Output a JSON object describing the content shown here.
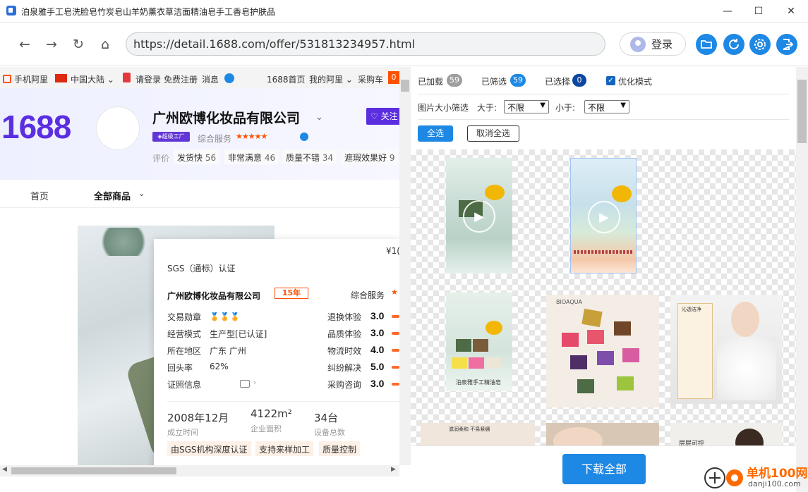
{
  "window": {
    "title": "泊泉雅手工皂洗脸皂竹炭皂山羊奶薰衣草洁面精油皂手工香皂护肤品",
    "min": "—",
    "max": "☐",
    "close": "✕"
  },
  "toolbar": {
    "back": "←",
    "forward": "→",
    "reload": "↻",
    "home": "⌂",
    "url": "https://detail.1688.com/offer/531813234957.html",
    "login": "登录"
  },
  "site": {
    "topstrip": {
      "mobile": "手机阿里",
      "region": "中国大陆 ⌄",
      "login": "请登录",
      "register": "免费注册",
      "messages": "消息",
      "home": "1688首页",
      "my": "我的阿里 ⌄",
      "cart": "采购车",
      "cart_count": "0"
    },
    "logo": "1688",
    "company": "广州欧博化妆品有限公司",
    "chevron": "⌄",
    "follow": "♡ 关注",
    "super_badge": "◈超级工厂",
    "svc_label": "综合服务",
    "svc_stars": "★★★★★",
    "eval_label": "评价",
    "eval_tags": [
      {
        "label": "发货快",
        "count": "56"
      },
      {
        "label": "非常满意",
        "count": "46"
      },
      {
        "label": "质量不错",
        "count": "34"
      },
      {
        "label": "遮瑕效果好",
        "count": "9"
      }
    ],
    "nav_home": "首页",
    "nav_all": "全部商品",
    "nav_chev": "⌄",
    "popup": {
      "price": "¥1(",
      "sgs": "SGS（通标）认证",
      "company": "广州欧博化妆品有限公司",
      "years": "15年",
      "svc": "综合服务",
      "svc_star": "★",
      "rows_left": [
        {
          "label": "交易勋章",
          "value": ""
        },
        {
          "label": "经营模式",
          "value": "生产型[已认证]"
        },
        {
          "label": "所在地区",
          "value": "广东 广州"
        },
        {
          "label": "回头率",
          "value": "62%"
        },
        {
          "label": "证照信息",
          "value": ""
        }
      ],
      "medals": "🏅🏅🏅",
      "cert_chev": "›",
      "rows_right": [
        {
          "label": "退换体验",
          "score": "3.0"
        },
        {
          "label": "品质体验",
          "score": "3.0"
        },
        {
          "label": "物流时效",
          "score": "4.0"
        },
        {
          "label": "纠纷解决",
          "score": "5.0"
        },
        {
          "label": "采购咨询",
          "score": "3.0"
        }
      ],
      "stats": [
        {
          "value": "2008年12月",
          "caption": "成立时间"
        },
        {
          "value": "4122m²",
          "caption": "企业面积"
        },
        {
          "value": "34台",
          "caption": "设备总数"
        }
      ],
      "tags": [
        "由SGS机构深度认证",
        "支持来样加工",
        "质量控制"
      ]
    }
  },
  "panel": {
    "loaded_label": "已加载",
    "loaded_count": "59",
    "filtered_label": "已筛选",
    "filtered_count": "59",
    "selected_label": "已选择",
    "selected_count": "0",
    "optimize_label": "优化模式",
    "optimize_checked": true,
    "filter_label": "图片大小筛选",
    "gt_label": "大于:",
    "gt_value": "不限",
    "lt_label": "小于:",
    "lt_value": "不限",
    "select_all": "全选",
    "deselect_all": "取消全选",
    "thumbnails": [
      {
        "caption": ""
      },
      {
        "caption": ""
      },
      {
        "caption": "泊泉雅手工精油皂"
      },
      {
        "caption": "BIOAQUA"
      },
      {
        "caption": "沁透洁净"
      },
      {
        "caption": "滋润柔和 不易紧绷"
      },
      {
        "caption": ""
      },
      {
        "caption": "层层可控"
      }
    ],
    "download_all": "下载全部"
  },
  "watermark": {
    "name": "单机100网",
    "url": "danji100.com"
  },
  "colors": {
    "accent": "#1e88e5",
    "brand_1688": "#5b2ee0",
    "orange": "#ff5000"
  }
}
